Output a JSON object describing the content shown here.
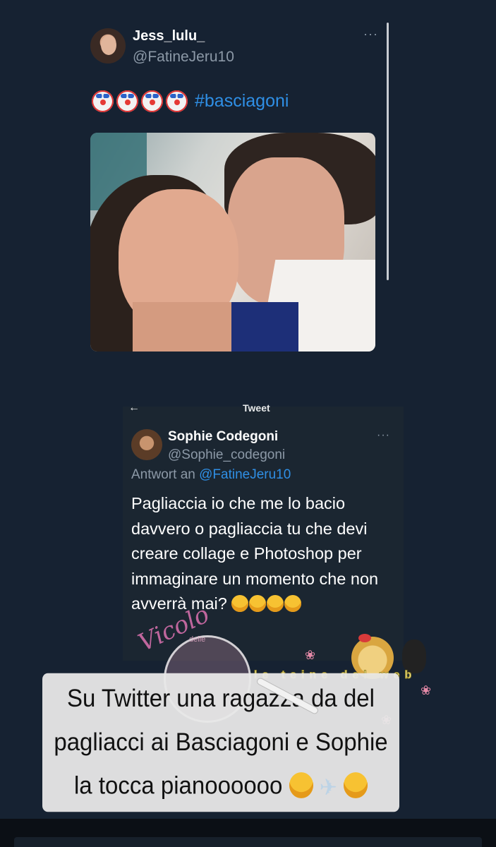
{
  "tweet": {
    "display_name": "Jess_lulu_",
    "handle": "@FatineJeru10",
    "more": "···",
    "emoji_icons": [
      "clown-face-icon",
      "clown-face-icon",
      "clown-face-icon",
      "clown-face-icon"
    ],
    "hashtag": "#basciagoni"
  },
  "embedded": {
    "header_back": "←",
    "header_title": "Tweet",
    "display_name": "Sophie Codegoni",
    "handle": "@Sophie_codegoni",
    "more": "···",
    "reply_prefix": "Antwort an",
    "reply_mention": "@FatineJeru10",
    "body": "Pagliaccia io che me lo bacio davvero o pagliaccia tu che devi creare collage e Photoshop per immaginare un momento che non avverrà mai?",
    "body_emoji_icons": [
      "rofl-icon",
      "rofl-icon",
      "rofl-icon",
      "rofl-icon"
    ]
  },
  "watermark": {
    "script_text": "Vicolo",
    "sub_text": "delle"
  },
  "sticker_brand": "le teine del web",
  "caption": {
    "text": "Su Twitter una ragazza da del pagliacci ai Basciagoni e Sophie la tocca pianoooooo",
    "emoji_icons": [
      "rofl-icon",
      "airplane-icon",
      "grinning-squinting-icon"
    ]
  },
  "colors": {
    "background": "#162232",
    "link_blue": "#2f8fe5",
    "muted_text": "#8c99a7",
    "caption_bg": "#e8e8e8"
  }
}
